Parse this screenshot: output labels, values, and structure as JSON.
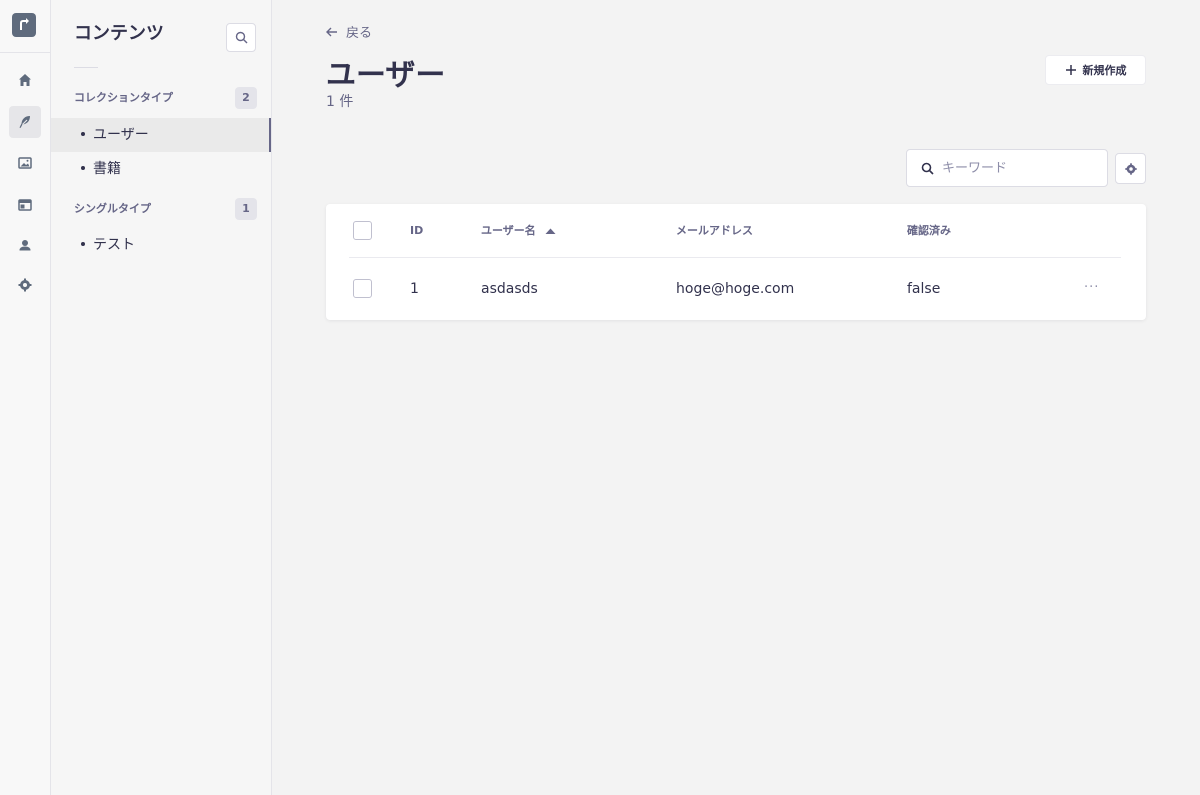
{
  "sidebar": {
    "title": "コンテンツ",
    "collection_section": {
      "label": "コレクションタイプ",
      "count": "2"
    },
    "collection_items": [
      "ユーザー",
      "書籍"
    ],
    "single_section": {
      "label": "シングルタイプ",
      "count": "1"
    },
    "single_items": [
      "テスト"
    ]
  },
  "header": {
    "back_label": "戻る",
    "title": "ユーザー",
    "count_text": "1 件",
    "create_label": "新規作成"
  },
  "search": {
    "placeholder": "キーワード"
  },
  "table": {
    "columns": {
      "id": "ID",
      "username": "ユーザー名",
      "email": "メールアドレス",
      "confirmed": "確認済み"
    },
    "rows": [
      {
        "id": "1",
        "username": "asdasds",
        "email": "hoge@hoge.com",
        "confirmed": "false",
        "menu": "···"
      }
    ]
  },
  "icons": {
    "rail": [
      "home-icon",
      "feather-icon",
      "images-icon",
      "layout-icon",
      "user-icon",
      "settings-icon"
    ],
    "search": "search-icon",
    "back": "arrow-left-icon",
    "create": "plus-icon",
    "sort": "caret-up-icon"
  },
  "colors": {
    "text": "#32324d",
    "muted": "#666687",
    "background": "#f3f3f3",
    "surface": "#ffffff"
  }
}
